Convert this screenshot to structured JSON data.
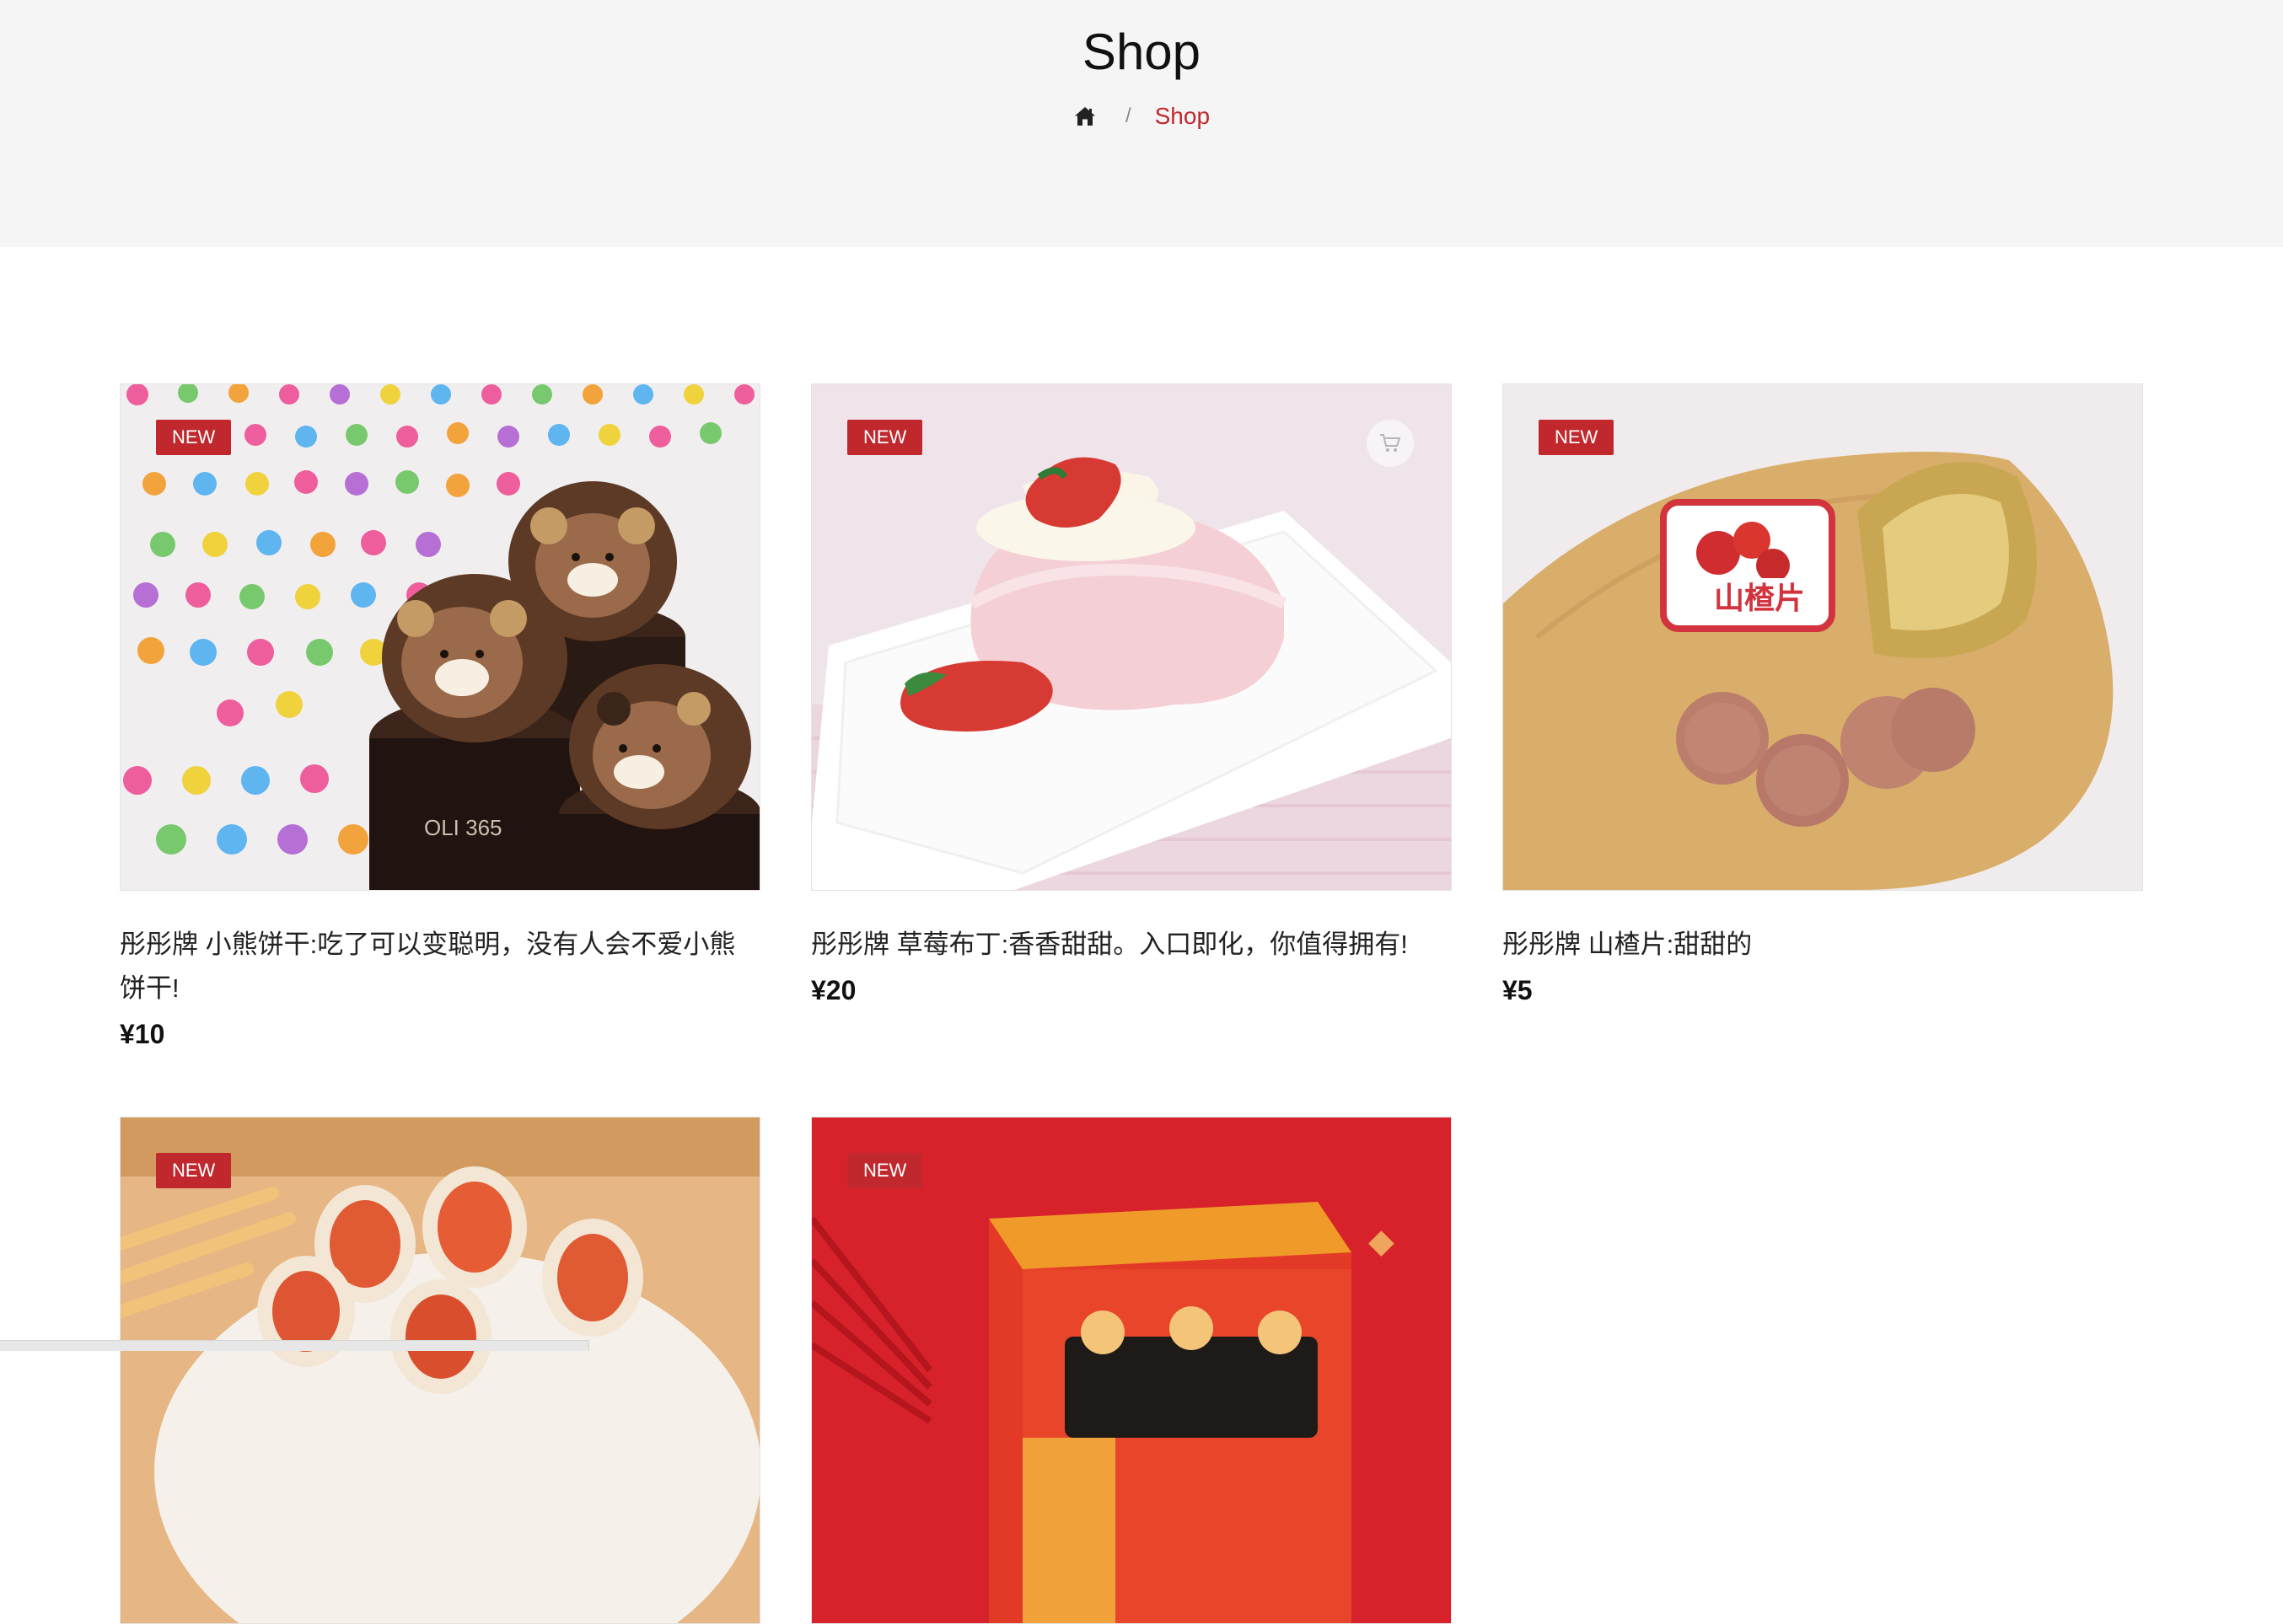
{
  "header": {
    "title": "Shop",
    "breadcrumb": {
      "home_icon": "home-icon",
      "separator": "/",
      "current": "Shop"
    }
  },
  "products": [
    {
      "badge": "NEW",
      "title": "彤彤牌 小熊饼干:吃了可以变聪明，没有人会不爱小熊饼干!",
      "price": "¥10"
    },
    {
      "badge": "NEW",
      "title": "彤彤牌 草莓布丁:香香甜甜。入口即化，你值得拥有!",
      "price": "¥20",
      "cart_icon": "cart-icon"
    },
    {
      "badge": "NEW",
      "title": "彤彤牌 山楂片:甜甜的",
      "price": "¥5"
    },
    {
      "badge": "NEW"
    },
    {
      "badge": "NEW"
    }
  ],
  "package_text": {
    "hawthorn_label": "山楂片"
  },
  "colors": {
    "accent": "#c0282d",
    "banner_bg": "#f5f5f5"
  }
}
